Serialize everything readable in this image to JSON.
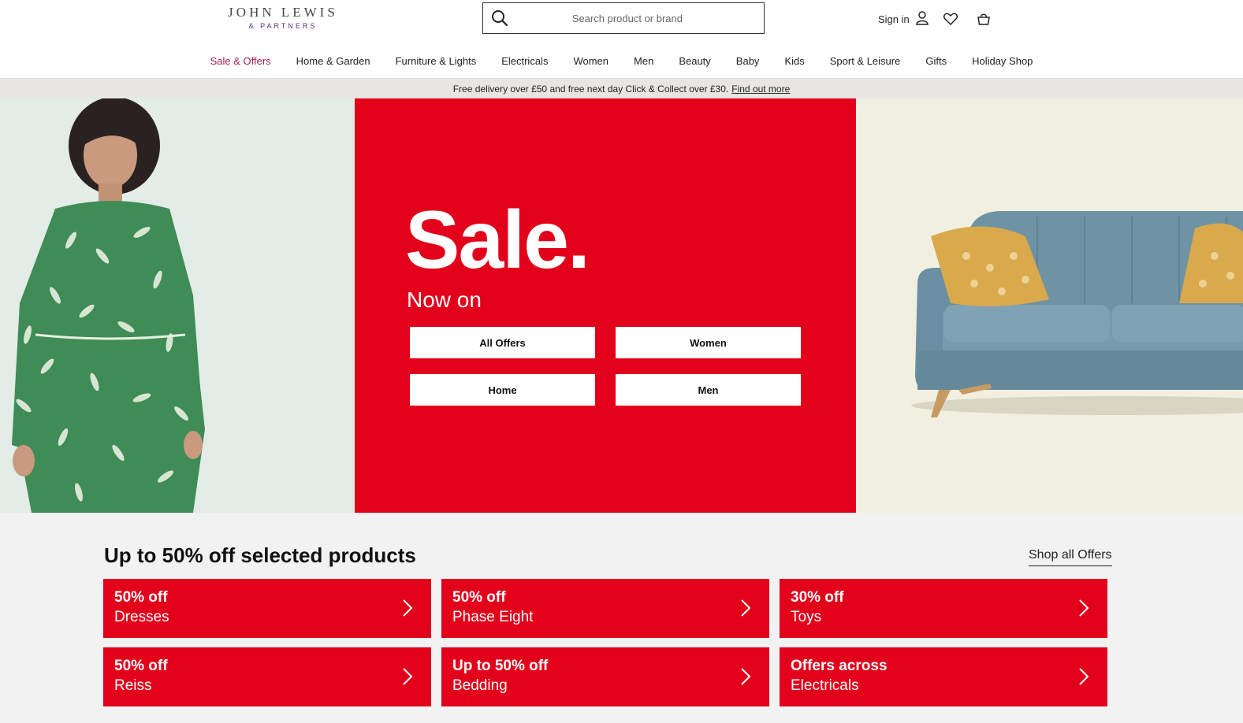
{
  "logo": {
    "main": "JOHN LEWIS",
    "sub": "& PARTNERS"
  },
  "search": {
    "placeholder": "Search product or brand"
  },
  "utils": {
    "signin_label": "Sign in"
  },
  "nav": {
    "items": [
      {
        "label": "Sale & Offers"
      },
      {
        "label": "Home & Garden"
      },
      {
        "label": "Furniture & Lights"
      },
      {
        "label": "Electricals"
      },
      {
        "label": "Women"
      },
      {
        "label": "Men"
      },
      {
        "label": "Beauty"
      },
      {
        "label": "Baby"
      },
      {
        "label": "Kids"
      },
      {
        "label": "Sport & Leisure"
      },
      {
        "label": "Gifts"
      },
      {
        "label": "Holiday Shop"
      }
    ]
  },
  "delivery": {
    "text": "Free delivery over £50 and free next day Click & Collect over £30.",
    "link": "Find out more"
  },
  "hero": {
    "title": "Sale.",
    "subtitle": "Now on",
    "buttons": {
      "all_offers": "All Offers",
      "women": "Women",
      "home": "Home",
      "men": "Men"
    }
  },
  "offers": {
    "title": "Up to 50% off selected products",
    "shop_all": "Shop all Offers",
    "tiles": [
      {
        "line1": "50% off",
        "line2": "Dresses"
      },
      {
        "line1": "50% off",
        "line2": "Phase Eight"
      },
      {
        "line1": "30% off",
        "line2": "Toys"
      },
      {
        "line1": "50% off",
        "line2": "Reiss"
      },
      {
        "line1": "Up to 50% off",
        "line2": "Bedding"
      },
      {
        "line1": "Offers across",
        "line2": "Electricals"
      }
    ]
  },
  "colors": {
    "brand_red": "#e2001a",
    "nav_active": "#a3214e"
  }
}
